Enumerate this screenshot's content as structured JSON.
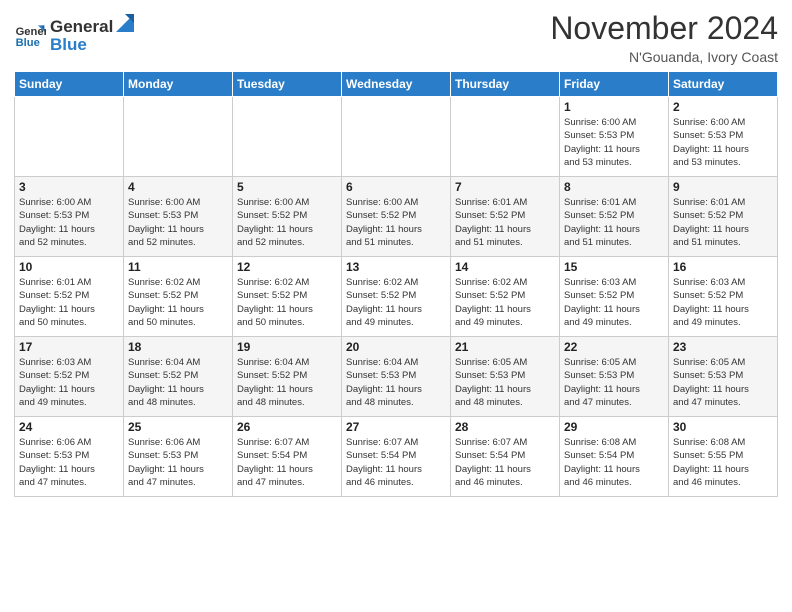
{
  "header": {
    "logo_line1": "General",
    "logo_line2": "Blue",
    "month": "November 2024",
    "location": "N'Gouanda, Ivory Coast"
  },
  "weekdays": [
    "Sunday",
    "Monday",
    "Tuesday",
    "Wednesday",
    "Thursday",
    "Friday",
    "Saturday"
  ],
  "weeks": [
    [
      {
        "day": "",
        "info": ""
      },
      {
        "day": "",
        "info": ""
      },
      {
        "day": "",
        "info": ""
      },
      {
        "day": "",
        "info": ""
      },
      {
        "day": "",
        "info": ""
      },
      {
        "day": "1",
        "info": "Sunrise: 6:00 AM\nSunset: 5:53 PM\nDaylight: 11 hours\nand 53 minutes."
      },
      {
        "day": "2",
        "info": "Sunrise: 6:00 AM\nSunset: 5:53 PM\nDaylight: 11 hours\nand 53 minutes."
      }
    ],
    [
      {
        "day": "3",
        "info": "Sunrise: 6:00 AM\nSunset: 5:53 PM\nDaylight: 11 hours\nand 52 minutes."
      },
      {
        "day": "4",
        "info": "Sunrise: 6:00 AM\nSunset: 5:53 PM\nDaylight: 11 hours\nand 52 minutes."
      },
      {
        "day": "5",
        "info": "Sunrise: 6:00 AM\nSunset: 5:52 PM\nDaylight: 11 hours\nand 52 minutes."
      },
      {
        "day": "6",
        "info": "Sunrise: 6:00 AM\nSunset: 5:52 PM\nDaylight: 11 hours\nand 51 minutes."
      },
      {
        "day": "7",
        "info": "Sunrise: 6:01 AM\nSunset: 5:52 PM\nDaylight: 11 hours\nand 51 minutes."
      },
      {
        "day": "8",
        "info": "Sunrise: 6:01 AM\nSunset: 5:52 PM\nDaylight: 11 hours\nand 51 minutes."
      },
      {
        "day": "9",
        "info": "Sunrise: 6:01 AM\nSunset: 5:52 PM\nDaylight: 11 hours\nand 51 minutes."
      }
    ],
    [
      {
        "day": "10",
        "info": "Sunrise: 6:01 AM\nSunset: 5:52 PM\nDaylight: 11 hours\nand 50 minutes."
      },
      {
        "day": "11",
        "info": "Sunrise: 6:02 AM\nSunset: 5:52 PM\nDaylight: 11 hours\nand 50 minutes."
      },
      {
        "day": "12",
        "info": "Sunrise: 6:02 AM\nSunset: 5:52 PM\nDaylight: 11 hours\nand 50 minutes."
      },
      {
        "day": "13",
        "info": "Sunrise: 6:02 AM\nSunset: 5:52 PM\nDaylight: 11 hours\nand 49 minutes."
      },
      {
        "day": "14",
        "info": "Sunrise: 6:02 AM\nSunset: 5:52 PM\nDaylight: 11 hours\nand 49 minutes."
      },
      {
        "day": "15",
        "info": "Sunrise: 6:03 AM\nSunset: 5:52 PM\nDaylight: 11 hours\nand 49 minutes."
      },
      {
        "day": "16",
        "info": "Sunrise: 6:03 AM\nSunset: 5:52 PM\nDaylight: 11 hours\nand 49 minutes."
      }
    ],
    [
      {
        "day": "17",
        "info": "Sunrise: 6:03 AM\nSunset: 5:52 PM\nDaylight: 11 hours\nand 49 minutes."
      },
      {
        "day": "18",
        "info": "Sunrise: 6:04 AM\nSunset: 5:52 PM\nDaylight: 11 hours\nand 48 minutes."
      },
      {
        "day": "19",
        "info": "Sunrise: 6:04 AM\nSunset: 5:52 PM\nDaylight: 11 hours\nand 48 minutes."
      },
      {
        "day": "20",
        "info": "Sunrise: 6:04 AM\nSunset: 5:53 PM\nDaylight: 11 hours\nand 48 minutes."
      },
      {
        "day": "21",
        "info": "Sunrise: 6:05 AM\nSunset: 5:53 PM\nDaylight: 11 hours\nand 48 minutes."
      },
      {
        "day": "22",
        "info": "Sunrise: 6:05 AM\nSunset: 5:53 PM\nDaylight: 11 hours\nand 47 minutes."
      },
      {
        "day": "23",
        "info": "Sunrise: 6:05 AM\nSunset: 5:53 PM\nDaylight: 11 hours\nand 47 minutes."
      }
    ],
    [
      {
        "day": "24",
        "info": "Sunrise: 6:06 AM\nSunset: 5:53 PM\nDaylight: 11 hours\nand 47 minutes."
      },
      {
        "day": "25",
        "info": "Sunrise: 6:06 AM\nSunset: 5:53 PM\nDaylight: 11 hours\nand 47 minutes."
      },
      {
        "day": "26",
        "info": "Sunrise: 6:07 AM\nSunset: 5:54 PM\nDaylight: 11 hours\nand 47 minutes."
      },
      {
        "day": "27",
        "info": "Sunrise: 6:07 AM\nSunset: 5:54 PM\nDaylight: 11 hours\nand 46 minutes."
      },
      {
        "day": "28",
        "info": "Sunrise: 6:07 AM\nSunset: 5:54 PM\nDaylight: 11 hours\nand 46 minutes."
      },
      {
        "day": "29",
        "info": "Sunrise: 6:08 AM\nSunset: 5:54 PM\nDaylight: 11 hours\nand 46 minutes."
      },
      {
        "day": "30",
        "info": "Sunrise: 6:08 AM\nSunset: 5:55 PM\nDaylight: 11 hours\nand 46 minutes."
      }
    ]
  ]
}
